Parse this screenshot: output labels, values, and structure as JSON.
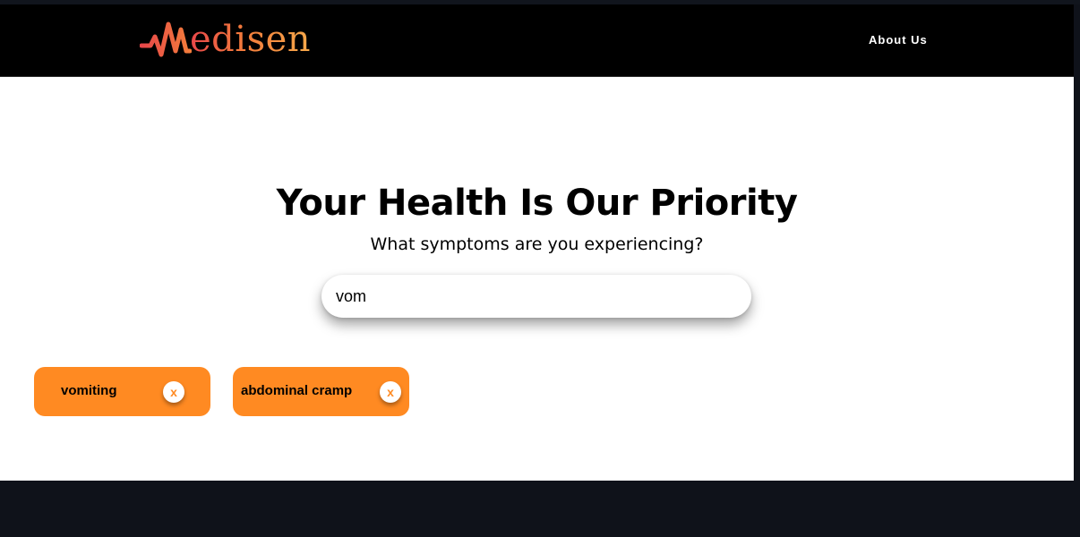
{
  "brand": {
    "name": "edisen",
    "logo_icon": "heartbeat-m-icon",
    "colors": {
      "gradient_start": "#e8474a",
      "gradient_mid": "#f37c3b",
      "gradient_end": "#f5a84a"
    }
  },
  "nav": {
    "about_label": "About Us"
  },
  "hero": {
    "title": "Your Health Is Our Priority",
    "subtitle": "What symptoms are you experiencing?"
  },
  "search": {
    "value": "vom",
    "placeholder": ""
  },
  "selected_symptoms": [
    {
      "label": "vomiting",
      "remove_label": "x"
    },
    {
      "label": "abdominal cramp",
      "remove_label": "x"
    }
  ],
  "theme": {
    "tag_color": "#ff8a22",
    "nav_bg": "#000000",
    "page_bg": "#0f121a"
  }
}
